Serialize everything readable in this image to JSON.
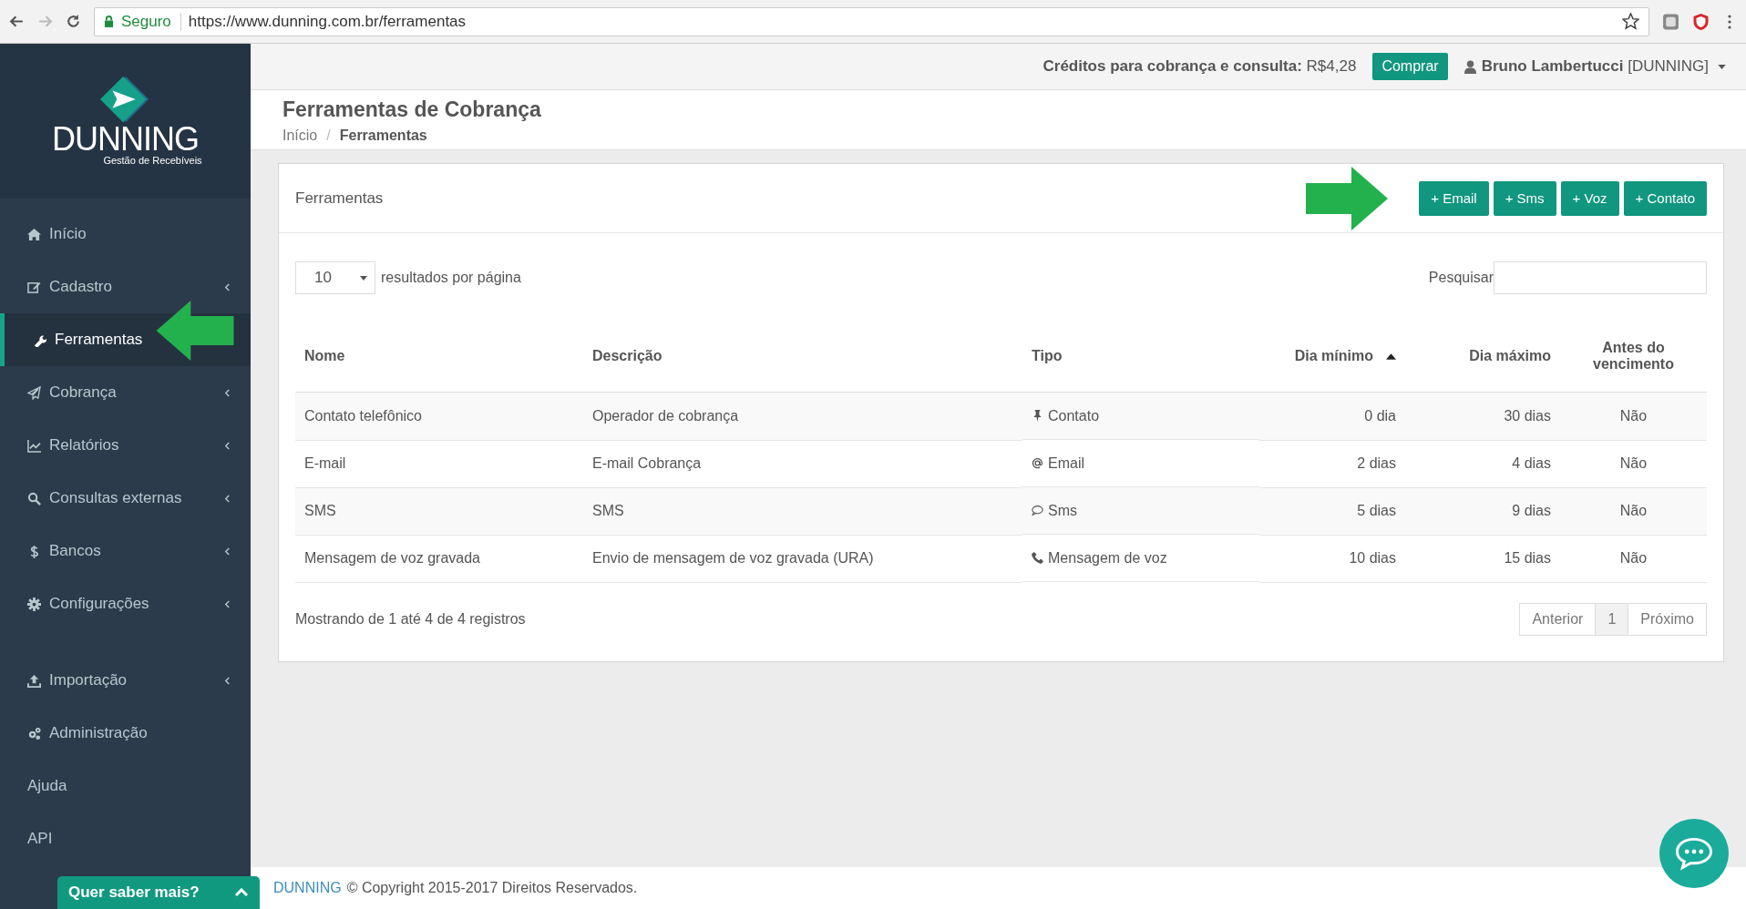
{
  "browser": {
    "secure_label": "Seguro",
    "url": "https://www.dunning.com.br/ferramentas"
  },
  "header": {
    "credits_label": "Créditos para cobrança e consulta:",
    "credits_value": "R$4,28",
    "buy_button": "Comprar",
    "user_name": "Bruno Lambertucci",
    "user_org": "[DUNNING]"
  },
  "sidebar": {
    "logo_name": "DUNNING",
    "logo_tagline": "Gestão de Recebíveis",
    "groups": [
      [
        {
          "label": "Início",
          "expandable": false,
          "selected": false
        },
        {
          "label": "Cadastro",
          "expandable": true,
          "selected": false
        },
        {
          "label": "Ferramentas",
          "expandable": false,
          "selected": true
        },
        {
          "label": "Cobrança",
          "expandable": true,
          "selected": false
        },
        {
          "label": "Relatórios",
          "expandable": true,
          "selected": false
        },
        {
          "label": "Consultas externas",
          "expandable": true,
          "selected": false
        },
        {
          "label": "Bancos",
          "expandable": true,
          "selected": false
        },
        {
          "label": "Configurações",
          "expandable": true,
          "selected": false
        }
      ],
      [
        {
          "label": "Importação",
          "expandable": true,
          "selected": false
        },
        {
          "label": "Administração",
          "expandable": false,
          "selected": false
        },
        {
          "label": "Ajuda",
          "expandable": false,
          "selected": false
        },
        {
          "label": "API",
          "expandable": false,
          "selected": false
        }
      ]
    ]
  },
  "page": {
    "title": "Ferramentas de Cobrança",
    "breadcrumb_separator": "/",
    "breadcrumb": [
      {
        "label": "Início",
        "selected": false
      },
      {
        "label": "Ferramentas",
        "selected": true
      }
    ]
  },
  "panel": {
    "title": "Ferramentas",
    "buttons": [
      "+ Email",
      "+ Sms",
      "+ Voz",
      "+ Contato"
    ],
    "page_size": "10",
    "page_size_label": "resultados por página",
    "search_label": "Pesquisar",
    "table": {
      "columns": [
        {
          "label": "Nome",
          "sorted": false
        },
        {
          "label": "Descrição",
          "sorted": false
        },
        {
          "label": "Tipo",
          "sorted": false
        },
        {
          "label": "Dia mínimo",
          "sorted": true
        },
        {
          "label": "Dia máximo",
          "sorted": false
        },
        {
          "label": "Antes do vencimento",
          "sorted": false
        }
      ],
      "rows": [
        {
          "kind": "contact",
          "cells": [
            "Contato telefônico",
            "Operador de cobrança",
            "Contato",
            "0 dia",
            "30 dias",
            "Não"
          ]
        },
        {
          "kind": "email",
          "cells": [
            "E-mail",
            "E-mail Cobrança",
            "Email",
            "2 dias",
            "4 dias",
            "Não"
          ]
        },
        {
          "kind": "sms",
          "cells": [
            "SMS",
            "SMS",
            "Sms",
            "5 dias",
            "9 dias",
            "Não"
          ]
        },
        {
          "kind": "voice",
          "cells": [
            "Mensagem de voz gravada",
            "Envio de mensagem de voz gravada (URA)",
            "Mensagem de voz",
            "10 dias",
            "15 dias",
            "Não"
          ]
        }
      ]
    },
    "info": "Mostrando de 1 até 4 de 4 registros",
    "pagination": [
      {
        "label": "Anterior",
        "selected": false
      },
      {
        "label": "1",
        "selected": true
      },
      {
        "label": "Próximo",
        "selected": false
      }
    ]
  },
  "footer": {
    "brand": "DUNNING",
    "text": "© Copyright 2015-2017 Direitos Reservados."
  },
  "help_widget": {
    "label": "Quer saber mais?"
  }
}
